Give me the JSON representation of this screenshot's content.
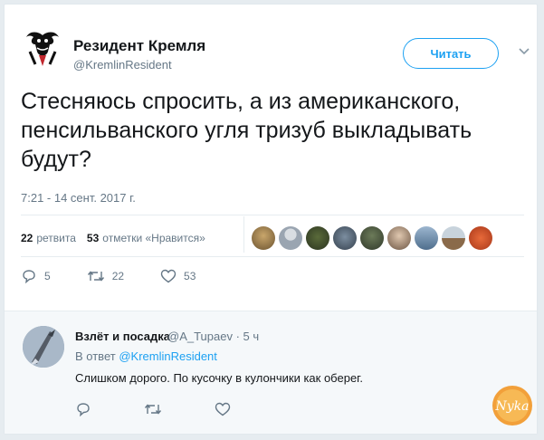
{
  "tweet": {
    "author_name": "Резидент Кремля",
    "author_handle": "@KremlinResident",
    "follow_label": "Читать",
    "text": "Стесняюсь спросить, а из американского, пенсильванского угля тризуб выкладывать будут?",
    "timestamp": "7:21 - 14 сент. 2017 г.",
    "retweets_count": "22",
    "retweets_label": "ретвита",
    "likes_count": "53",
    "likes_label": "отметки «Нравится»",
    "actions": {
      "reply_count": "5",
      "retweet_count": "22",
      "like_count": "53"
    }
  },
  "reply": {
    "author_name": "Взлёт и посадка",
    "meta": "@A_Tupaev · 5 ч",
    "reply_prefix": "В ответ",
    "reply_to": "@KremlinResident",
    "text": "Слишком дорого. По кусочку в кулончики как оберег."
  },
  "watermark": {
    "text": "Nyka"
  },
  "colors": {
    "accent": "#1da1f2",
    "secondary_text": "#657786",
    "text": "#14171a"
  },
  "icons": [
    "caret-down-icon",
    "reply-icon",
    "retweet-icon",
    "like-icon"
  ]
}
